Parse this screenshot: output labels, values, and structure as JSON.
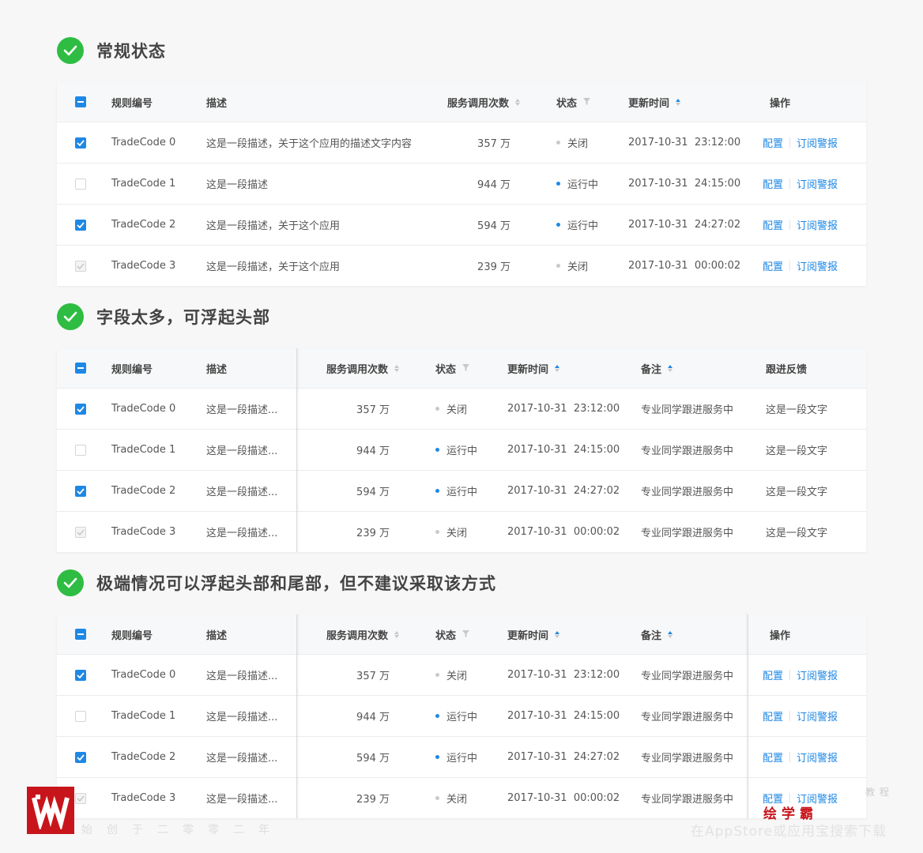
{
  "sections": [
    {
      "title": "常规状态",
      "columns": {
        "code": "规则编号",
        "desc": "描述",
        "calls": "服务调用次数",
        "status": "状态",
        "time": "更新时间",
        "action": "操作"
      },
      "rows": [
        {
          "checkbox": "checked",
          "code": "TradeCode 0",
          "desc": "这是一段描述，关于这个应用的描述文字内容",
          "calls": "357 万",
          "status": "关闭",
          "status_color": "gray",
          "time": "2017-10-31  23:12:00",
          "action_config": "配置",
          "action_subscribe": "订阅警报"
        },
        {
          "checkbox": "unchecked",
          "code": "TradeCode 1",
          "desc": "这是一段描述",
          "calls": "944 万",
          "status": "运行中",
          "status_color": "blue",
          "time": "2017-10-31  24:15:00",
          "action_config": "配置",
          "action_subscribe": "订阅警报"
        },
        {
          "checkbox": "checked",
          "code": "TradeCode 2",
          "desc": "这是一段描述，关于这个应用",
          "calls": "594 万",
          "status": "运行中",
          "status_color": "blue",
          "time": "2017-10-31  24:27:02",
          "action_config": "配置",
          "action_subscribe": "订阅警报"
        },
        {
          "checkbox": "disabled",
          "code": "TradeCode 3",
          "desc": "这是一段描述，关于这个应用",
          "calls": "239 万",
          "status": "关闭",
          "status_color": "gray",
          "time": "2017-10-31  00:00:02",
          "action_config": "配置",
          "action_subscribe": "订阅警报"
        }
      ]
    },
    {
      "title": "字段太多，可浮起头部",
      "columns": {
        "code": "规则编号",
        "desc": "描述",
        "calls": "服务调用次数",
        "status": "状态",
        "time": "更新时间",
        "note": "备注",
        "feedback": "跟进反馈"
      },
      "rows": [
        {
          "checkbox": "checked",
          "code": "TradeCode 0",
          "desc": "这是一段描述...",
          "calls": "357 万",
          "status": "关闭",
          "status_color": "gray",
          "time": "2017-10-31  23:12:00",
          "note": "专业同学跟进服务中",
          "feedback": "这是一段文字"
        },
        {
          "checkbox": "unchecked",
          "code": "TradeCode 1",
          "desc": "这是一段描述...",
          "calls": "944 万",
          "status": "运行中",
          "status_color": "blue",
          "time": "2017-10-31  24:15:00",
          "note": "专业同学跟进服务中",
          "feedback": "这是一段文字"
        },
        {
          "checkbox": "checked",
          "code": "TradeCode 2",
          "desc": "这是一段描述...",
          "calls": "594 万",
          "status": "运行中",
          "status_color": "blue",
          "time": "2017-10-31  24:27:02",
          "note": "专业同学跟进服务中",
          "feedback": "这是一段文字"
        },
        {
          "checkbox": "disabled",
          "code": "TradeCode 3",
          "desc": "这是一段描述...",
          "calls": "239 万",
          "status": "关闭",
          "status_color": "gray",
          "time": "2017-10-31  00:00:02",
          "note": "专业同学跟进服务中",
          "feedback": "这是一段文字"
        }
      ]
    },
    {
      "title": "极端情况可以浮起头部和尾部，但不建议采取该方式",
      "columns": {
        "code": "规则编号",
        "desc": "描述",
        "calls": "服务调用次数",
        "status": "状态",
        "time": "更新时间",
        "note": "备注",
        "action": "操作"
      },
      "rows": [
        {
          "checkbox": "checked",
          "code": "TradeCode 0",
          "desc": "这是一段描述...",
          "calls": "357 万",
          "status": "关闭",
          "status_color": "gray",
          "time": "2017-10-31  23:12:00",
          "note": "专业同学跟进服务中",
          "action_config": "配置",
          "action_subscribe": "订阅警报"
        },
        {
          "checkbox": "unchecked",
          "code": "TradeCode 1",
          "desc": "这是一段描述...",
          "calls": "944 万",
          "status": "运行中",
          "status_color": "blue",
          "time": "2017-10-31  24:15:00",
          "note": "专业同学跟进服务中",
          "action_config": "配置",
          "action_subscribe": "订阅警报"
        },
        {
          "checkbox": "checked",
          "code": "TradeCode 2",
          "desc": "这是一段描述...",
          "calls": "594 万",
          "status": "运行中",
          "status_color": "blue",
          "time": "2017-10-31  24:27:02",
          "note": "专业同学跟进服务中",
          "action_config": "配置",
          "action_subscribe": "订阅警报"
        },
        {
          "checkbox": "disabled",
          "code": "TradeCode 3",
          "desc": "这是一段描述...",
          "calls": "239 万",
          "status": "关闭",
          "status_color": "gray",
          "time": "2017-10-31  00:00:02",
          "note": "专业同学跟进服务中",
          "action_config": "配置",
          "action_subscribe": "订阅警报"
        }
      ]
    }
  ],
  "watermark": {
    "logo_letter": "W",
    "slogan": "始创于二零零二年",
    "brand": "绘学霸",
    "tag": "教程",
    "sub": "在AppStore或应用宝搜索下载"
  },
  "colors": {
    "accent": "#1e88e5",
    "success": "#2ebd42",
    "brand_red": "#c8151b"
  }
}
